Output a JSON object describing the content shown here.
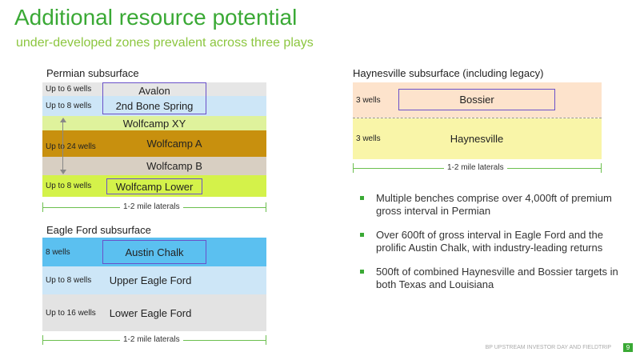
{
  "title": "Additional resource potential",
  "subtitle": "under-developed zones prevalent across three plays",
  "permian": {
    "heading": "Permian subsurface",
    "bands": [
      {
        "wells": "Up to 6 wells",
        "zone": "Avalon"
      },
      {
        "wells": "Up to 8 wells",
        "zone": "2nd Bone Spring"
      },
      {
        "wells": "",
        "zone": "Wolfcamp XY"
      },
      {
        "wells": "Up to 24 wells",
        "zone": "Wolfcamp A"
      },
      {
        "wells": "",
        "zone": "Wolfcamp B"
      },
      {
        "wells": "Up to 8 wells",
        "zone": "Wolfcamp Lower"
      }
    ],
    "laterals": "1-2 mile laterals"
  },
  "eagle_ford": {
    "heading": "Eagle Ford subsurface",
    "bands": [
      {
        "wells": "8 wells",
        "zone": "Austin Chalk"
      },
      {
        "wells": "Up to 8 wells",
        "zone": "Upper Eagle Ford"
      },
      {
        "wells": "Up to 16 wells",
        "zone": "Lower Eagle Ford"
      }
    ],
    "laterals": "1-2 mile laterals"
  },
  "haynesville": {
    "heading": "Haynesville subsurface (including legacy)",
    "bands": [
      {
        "wells": "3 wells",
        "zone": "Bossier"
      },
      {
        "wells": "3 wells",
        "zone": "Haynesville"
      }
    ],
    "laterals": "1-2 mile laterals"
  },
  "bullets": [
    "Multiple benches comprise over 4,000ft of premium gross interval in Permian",
    "Over 600ft of gross interval in Eagle Ford and the prolific Austin Chalk, with industry-leading returns",
    "500ft of combined Haynesville and Bossier targets in both Texas and Louisiana"
  ],
  "footer": "BP UPSTREAM INVESTOR DAY AND FIELDTRIP",
  "page_number": "9",
  "colors": {
    "title": "#3aa935",
    "subtitle": "#8cc63f",
    "avalon": "#e6e6e6",
    "bone_spring": "#cde6f7",
    "wolfcamp_xy": "#dff29c",
    "wolfcamp_a": "#c8900e",
    "wolfcamp_b": "#d8cfc2",
    "wolfcamp_lower": "#d4f24a",
    "austin_chalk": "#5bc0f0",
    "upper_eagle_ford": "#cde6f7",
    "lower_eagle_ford": "#e3e3e3",
    "bossier": "#fde3cc",
    "haynesville": "#f9f5a8",
    "box_outline": "#6a51c9",
    "lateral_line": "#6cbf4f"
  }
}
